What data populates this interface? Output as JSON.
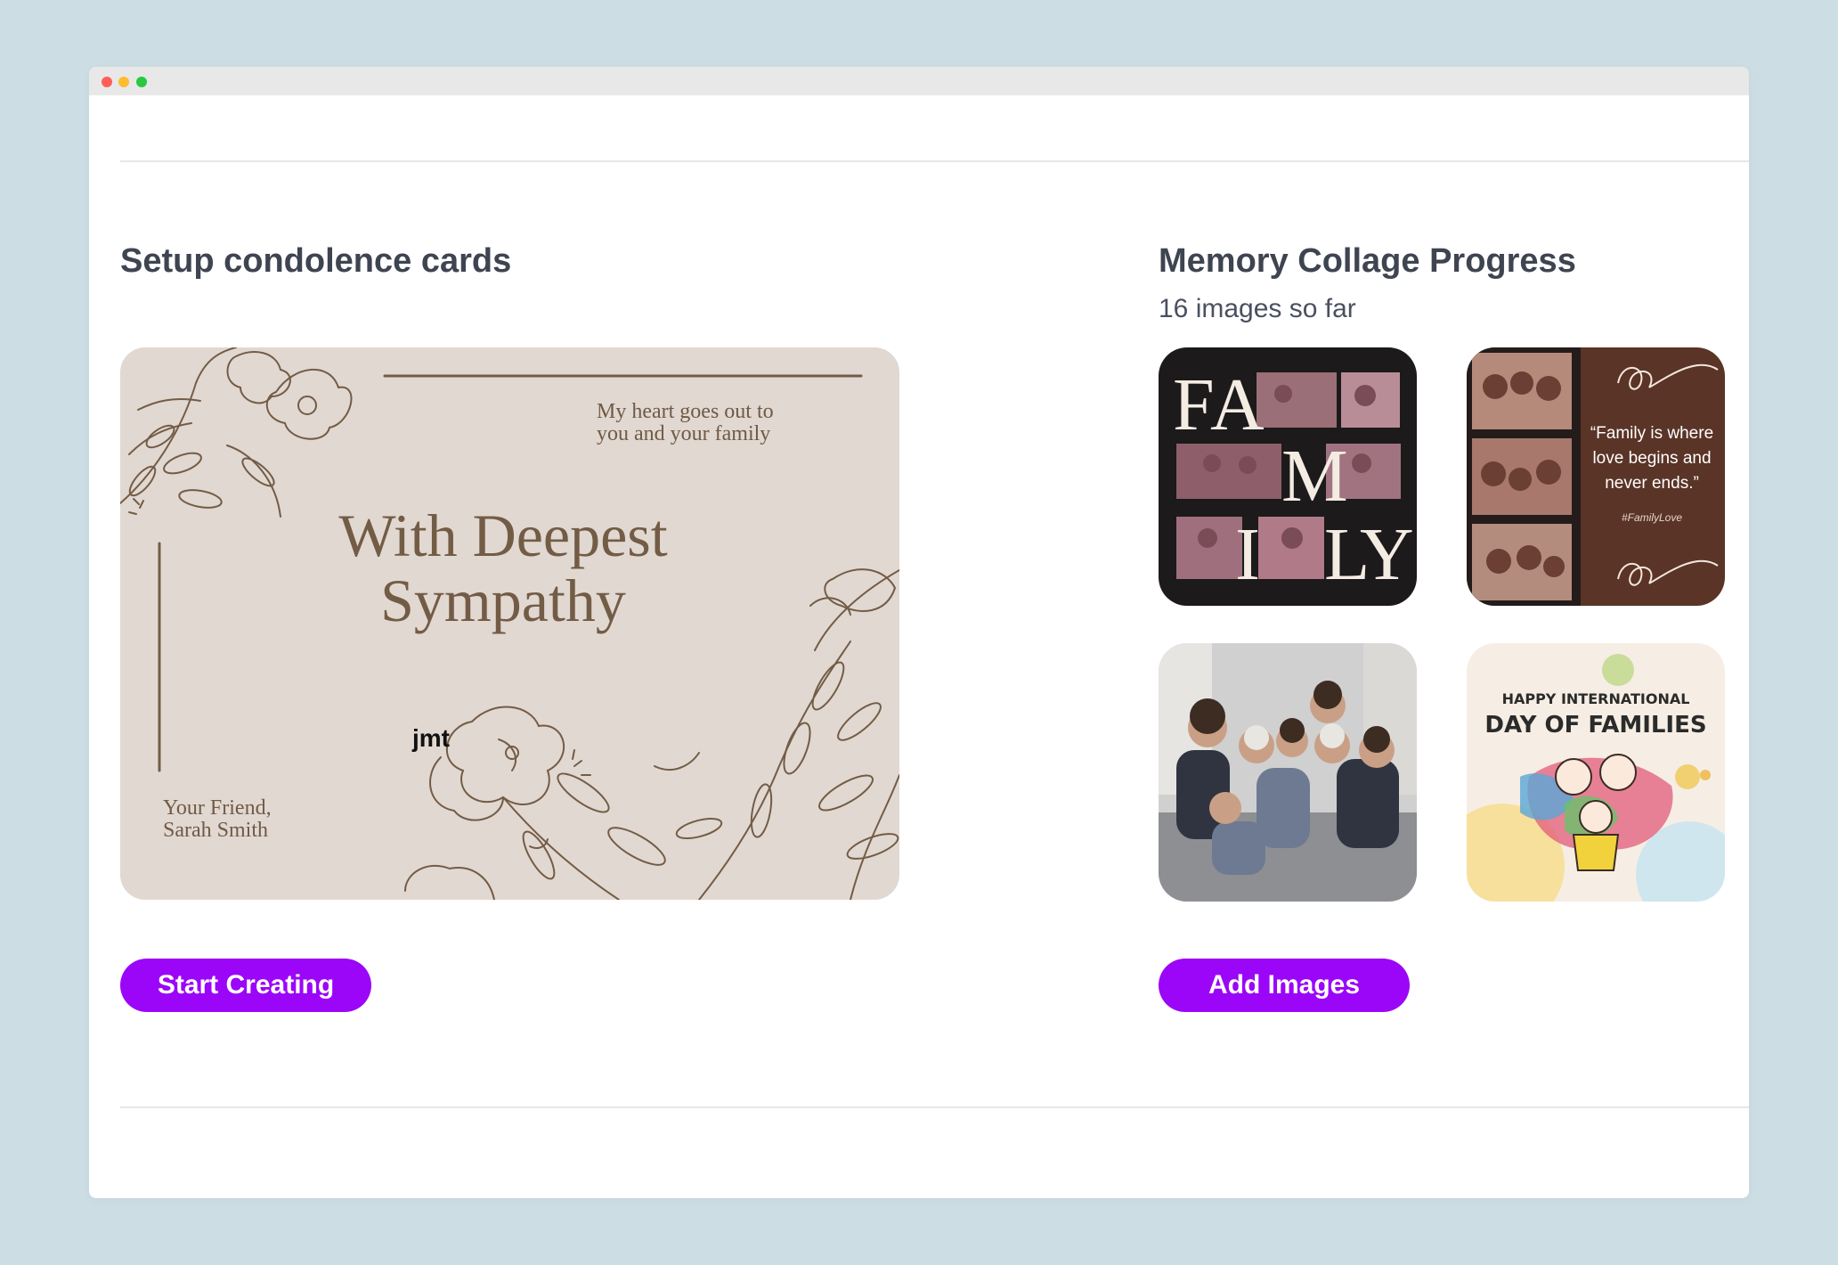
{
  "window": {
    "traffic_lights": [
      "#ff5f57",
      "#febc2e",
      "#28c840"
    ]
  },
  "condolence": {
    "heading": "Setup condolence cards",
    "card": {
      "message_line1": "My heart goes out to",
      "message_line2": "you and your family",
      "title_line1": "With Deepest",
      "title_line2": "Sympathy",
      "signature_line1": "Your Friend,",
      "signature_line2": "Sarah Smith",
      "initials": "jmt",
      "background_color": "#e1d8d1",
      "ink_color": "#735c46"
    },
    "button_label": "Start Creating"
  },
  "collage": {
    "heading": "Memory Collage Progress",
    "subheading": "16 images so far",
    "images": [
      {
        "id": "family-letters",
        "letters": [
          "F",
          "A",
          "M",
          "I",
          "L",
          "Y"
        ]
      },
      {
        "id": "family-quote",
        "quote_line1": "“Family is where",
        "quote_line2": "love begins and",
        "quote_line3": "never ends.”",
        "hashtag": "#FamilyLove"
      },
      {
        "id": "family-photo"
      },
      {
        "id": "families-day",
        "line1": "HAPPY INTERNATIONAL",
        "line2": "DAY OF FAMILIES"
      }
    ],
    "button_label": "Add Images"
  },
  "colors": {
    "accent": "#9b06f8",
    "heading_text": "#3f4451",
    "page_background": "#cddde4"
  }
}
